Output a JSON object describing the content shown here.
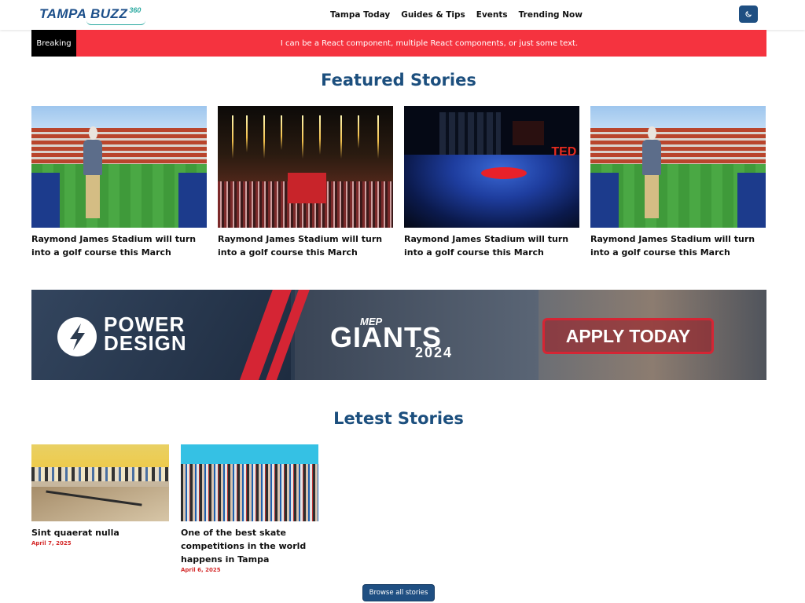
{
  "header": {
    "logo_text": "TAMPA BUZZ",
    "logo_badge": "360",
    "nav": [
      "Tampa Today",
      "Guides & Tips",
      "Events",
      "Trending Now"
    ],
    "theme_toggle_icon": "moon-icon"
  },
  "breaking": {
    "label": "Breaking",
    "text": "I can be a React component, multiple React components, or just some text."
  },
  "featured": {
    "title": "Featured Stories",
    "stories": [
      {
        "title": "Raymond James Stadium will turn into a golf course this March",
        "image": "golfer-stadium"
      },
      {
        "title": "Raymond James Stadium will turn into a golf course this March",
        "image": "fireworks-stadium"
      },
      {
        "title": "Raymond James Stadium will turn into a golf course this March",
        "image": "ted-talk"
      },
      {
        "title": "Raymond James Stadium will turn into a golf course this March",
        "image": "golfer-stadium"
      }
    ]
  },
  "ad": {
    "brand_line1": "POWER",
    "brand_line2": "DESIGN",
    "event_top": "MEP",
    "event_name": "GIANTS",
    "event_year": "2024",
    "cta": "APPLY TODAY"
  },
  "latest": {
    "title": "Letest Stories",
    "stories": [
      {
        "title": "Sint quaerat nulla",
        "date": "April 7, 2025",
        "image": "skatepark"
      },
      {
        "title": "One of the best skate competitions in the world happens in Tampa",
        "date": "April 6, 2025",
        "image": "skate-crowd"
      }
    ],
    "browse_label": "Browse all stories"
  },
  "colors": {
    "brand_blue": "#1c4f7e",
    "breaking_red": "#f5333f",
    "date_red": "#d42a2a"
  }
}
